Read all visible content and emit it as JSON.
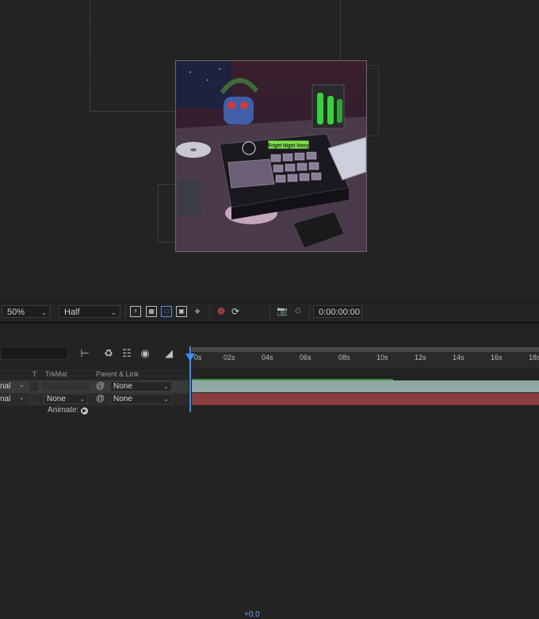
{
  "viewer": {
    "zoom": "50%",
    "resolution": "Half",
    "exposure": "+0.0",
    "timecode": "0:00:00:00",
    "composition_image": {
      "sign_text": "Fright Night Story",
      "colors": {
        "room": "#3a2a3c",
        "box": "#1c1820",
        "pad": "#6a5e78",
        "tube": "#37d23a",
        "sign": "#7ee04a"
      }
    }
  },
  "timeline": {
    "ruler_ticks": [
      "0s",
      "02s",
      "04s",
      "06s",
      "08s",
      "10s",
      "12s",
      "14s",
      "16s",
      "18s"
    ],
    "columns": {
      "t": "T",
      "trkmat": "TrkMat",
      "parent": "Parent & Link"
    },
    "layers": [
      {
        "mode": "nal",
        "trkmat": "",
        "parent": "None"
      },
      {
        "mode": "nal",
        "trkmat": "None",
        "parent": "None"
      }
    ],
    "animate_label": "Animate:",
    "colors": {
      "playhead": "#3f8bf0",
      "layer1": "#8fa8a4",
      "layer2": "#8a3d3d",
      "progress": "#3f8f3f"
    }
  }
}
